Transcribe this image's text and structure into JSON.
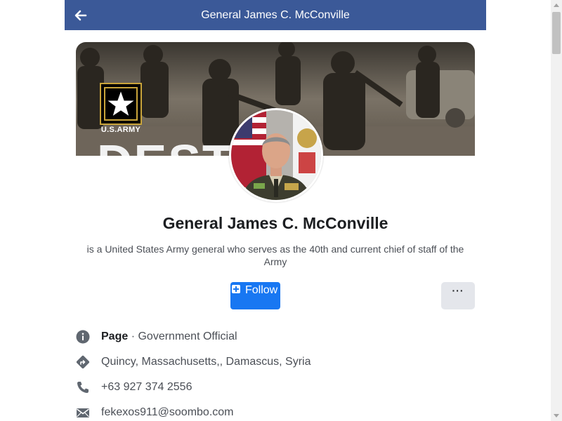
{
  "header": {
    "title": "General James C. McConville",
    "back_icon": "arrow-left-icon",
    "background": "#3b5998"
  },
  "cover": {
    "logo_text": "U.S.ARMY",
    "overlay_text": "DEST"
  },
  "profile": {
    "name": "General James C. McConville",
    "bio": "is a United States Army general who serves as the 40th and current chief of staff of the Army"
  },
  "actions": {
    "follow_label": "Follow",
    "follow_color": "#1877f2",
    "more_label": "···"
  },
  "info": {
    "category_strong": "Page",
    "category_rest": " · Government Official",
    "location": "Quincy, Massachusetts,, Damascus, Syria",
    "phone": "+63 927 374 2556",
    "email": "fekexos911@soombo.com"
  },
  "icons": {
    "category": "info-icon",
    "location": "directions-icon",
    "phone": "phone-icon",
    "email": "mail-icon"
  }
}
